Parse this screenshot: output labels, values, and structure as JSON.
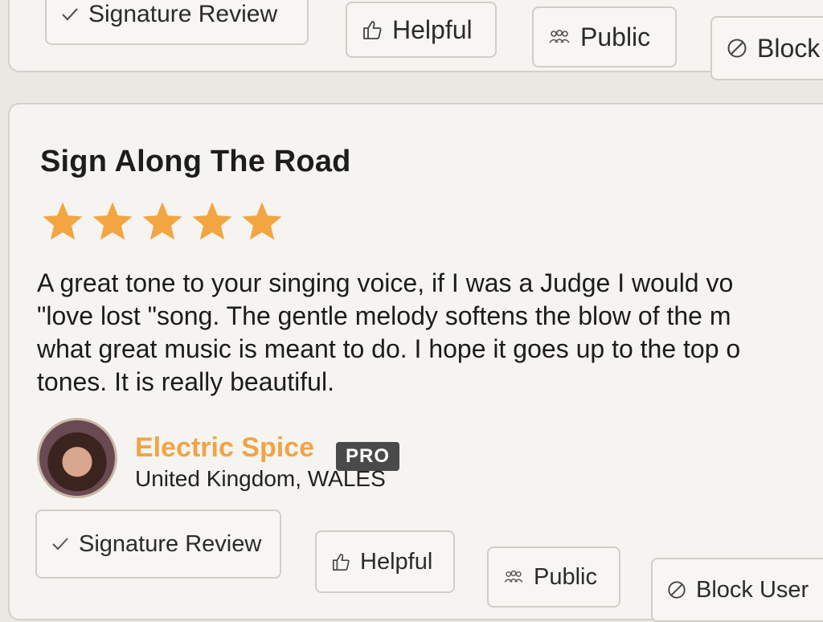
{
  "top_actions": {
    "signature_review": "Signature Review",
    "helpful": "Helpful",
    "public": "Public",
    "block_user": "Block"
  },
  "review": {
    "title": "Sign Along The Road",
    "rating": 5,
    "rating_max": 5,
    "text_lines": [
      "A great tone to your singing voice, if I was a Judge I would vo",
      "\"love lost \"song. The gentle melody softens the blow of the m",
      "what great music is meant to do. I hope it goes up to the top o",
      "tones. It is really beautiful."
    ],
    "author": {
      "name": "Electric Spice",
      "badge": "PRO",
      "location": "United Kingdom, WALES"
    }
  },
  "actions": {
    "signature_review": "Signature Review",
    "helpful": "Helpful",
    "public": "Public",
    "block_user": "Block User"
  },
  "colors": {
    "star": "#f2a541",
    "author_name": "#f0a447",
    "badge_bg": "#4a4a4a",
    "card_bg": "#f5f4f0",
    "border": "#cfcec8"
  },
  "icons": {
    "signature": "checkmark-icon",
    "helpful": "thumbs-up-icon",
    "public": "people-icon",
    "block": "block-icon"
  }
}
